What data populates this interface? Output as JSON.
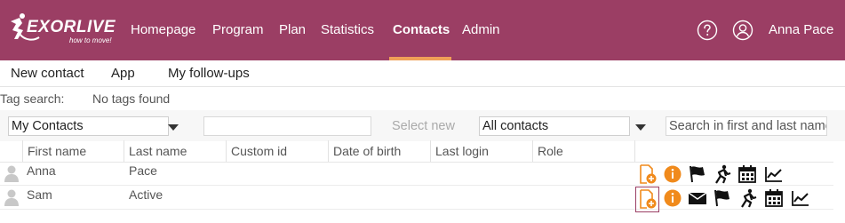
{
  "brand": {
    "logo_text": "EXORLIVE",
    "logo_tagline": "how to move!"
  },
  "nav": {
    "items": [
      "Homepage",
      "Program",
      "Plan",
      "Statistics",
      "Contacts",
      "Admin"
    ],
    "active": "Contacts"
  },
  "user": {
    "name": "Anna Pace"
  },
  "subnav": {
    "items": [
      "New contact",
      "App",
      "My follow-ups"
    ]
  },
  "tags": {
    "label": "Tag search:",
    "value": "No tags found"
  },
  "filters": {
    "contact_list": "My Contacts",
    "select_new": "Select new",
    "contact_filter": "All contacts",
    "search_placeholder": "Search in first and last name",
    "search_value": ""
  },
  "table": {
    "columns": [
      "First name",
      "Last name",
      "Custom id",
      "Date of birth",
      "Last login",
      "Role"
    ],
    "rows": [
      {
        "first_name": "Anna",
        "last_name": "Pace",
        "actions": [
          "add-program",
          "info",
          "flag",
          "exercise",
          "calendar",
          "statistics"
        ]
      },
      {
        "first_name": "Sam",
        "last_name": "Active",
        "actions": [
          "add-program",
          "info",
          "mail",
          "flag",
          "exercise",
          "calendar",
          "statistics"
        ]
      }
    ]
  },
  "colors": {
    "topbar": "#9b3e64",
    "nav_active_underline": "#f0a058",
    "action_orange": "#f08a1c",
    "text_gray": "#555555"
  }
}
